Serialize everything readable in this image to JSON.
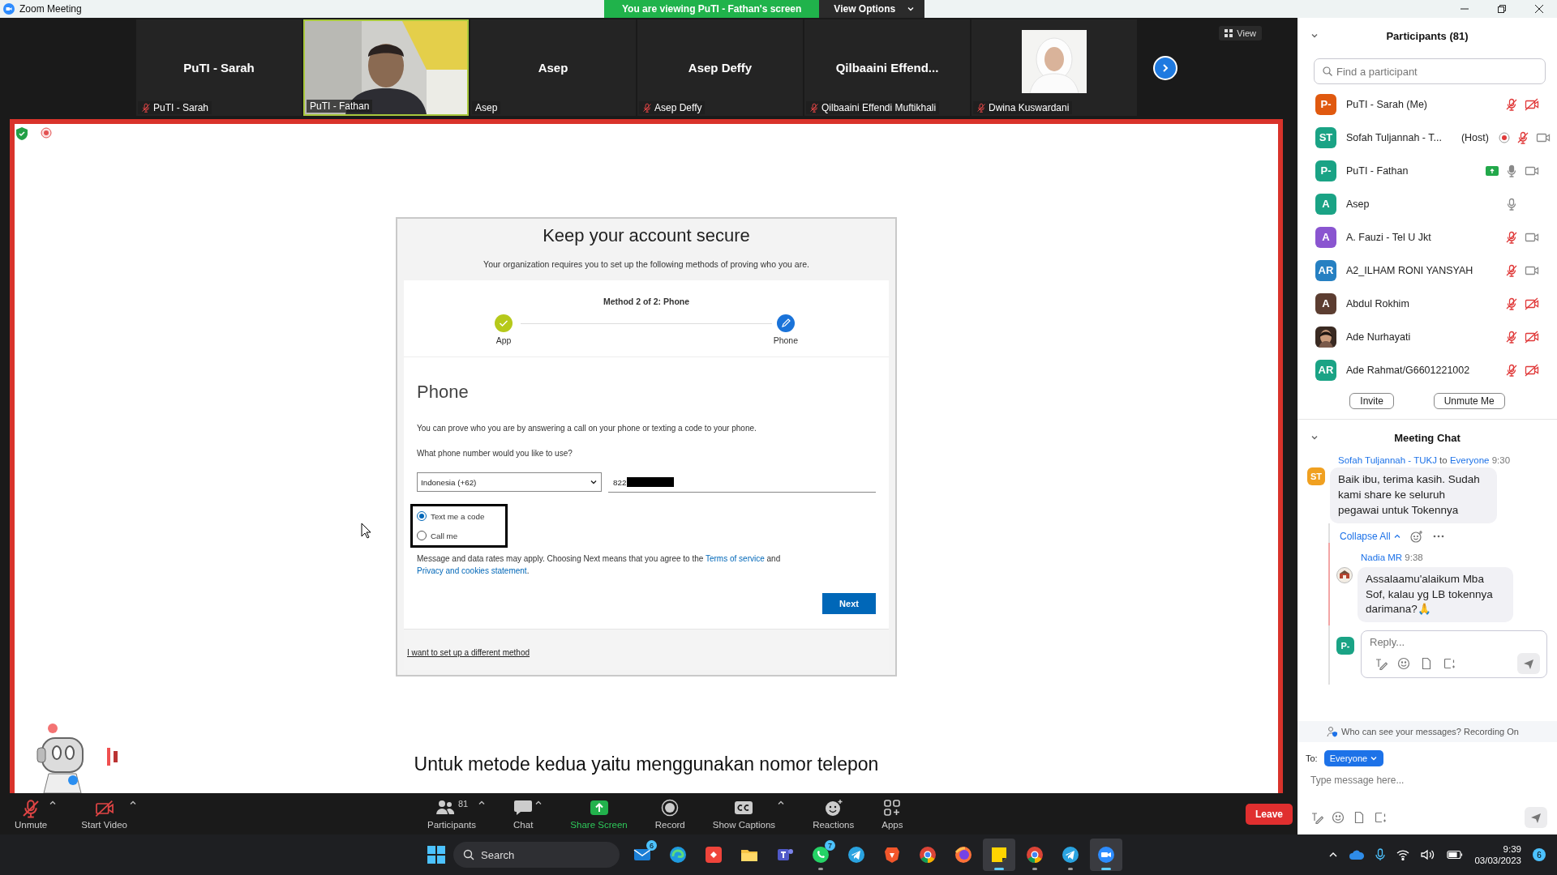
{
  "window": {
    "title": "Zoom Meeting"
  },
  "share_banner": {
    "text": "You are viewing PuTI - Fathan's screen",
    "button": "View Options"
  },
  "gallery": {
    "view_button": "View",
    "tiles": [
      {
        "kind": "name",
        "display": "PuTI - Sarah",
        "label": "PuTI - Sarah",
        "muted": true,
        "active": false
      },
      {
        "kind": "video",
        "label": "PuTI - Fathan",
        "muted": false,
        "active": true
      },
      {
        "kind": "name",
        "display": "Asep",
        "label": "Asep",
        "muted": false,
        "active": false
      },
      {
        "kind": "name",
        "display": "Asep Deffy",
        "label": "Asep Deffy",
        "muted": true,
        "active": false
      },
      {
        "kind": "name",
        "display": "Qilbaaini  Effend...",
        "label": "Qilbaaini Effendi Muftikhali",
        "muted": true,
        "active": false
      },
      {
        "label": "Dwina Kuswardani",
        "muted": true,
        "active": false
      }
    ]
  },
  "shared_screen": {
    "form": {
      "title": "Keep your account secure",
      "subtitle": "Your organization requires you to set up the following methods of proving who you are.",
      "method_label": "Method 2 of 2: Phone",
      "steps": [
        {
          "label": "App",
          "kind": "done"
        },
        {
          "label": "Phone",
          "kind": "current"
        }
      ],
      "heading": "Phone",
      "description": "You can prove who you are by answering a call on your phone or texting a code to your phone.",
      "question": "What phone number would you like to use?",
      "country": "Indonesia (+62)",
      "phone": "822",
      "options": [
        {
          "label": "Text me a code",
          "selected": true
        },
        {
          "label": "Call me",
          "selected": false
        }
      ],
      "legal": {
        "before": "Message and data rates may apply. Choosing Next means that you agree to the ",
        "link_1": "Terms of service",
        "middle": " and ",
        "link_2": "Privacy and cookies statement",
        "after": "."
      },
      "next_button": "Next",
      "alt_link": "I want to set up a different method"
    },
    "caption": "Untuk metode kedua yaitu menggunakan nomor telepon"
  },
  "participants": {
    "title": "Participants (81)",
    "search": {
      "placeholder": "Find a participant"
    },
    "items": [
      {
        "kind": "initials",
        "initials": "P-",
        "color": "#e0590f",
        "name": "PuTI - Sarah (Me)",
        "recording": false,
        "sharing": false,
        "muted": true,
        "talking": false,
        "video_off": true
      },
      {
        "kind": "initials",
        "initials": "ST",
        "color": "#1aa385",
        "name": "Sofah Tuljannah - T...",
        "role": "(Host)",
        "recording": true,
        "sharing": false,
        "muted": true,
        "talking": false,
        "video_off": false
      },
      {
        "kind": "initials",
        "initials": "P-",
        "color": "#1aa385",
        "name": "PuTI - Fathan",
        "recording": false,
        "sharing": true,
        "muted": false,
        "talking": true,
        "video_off": false
      },
      {
        "kind": "initials",
        "initials": "A",
        "color": "#1aa385",
        "name": "Asep",
        "recording": false,
        "sharing": false,
        "muted": false,
        "talking": false
      },
      {
        "kind": "initials",
        "initials": "A",
        "color": "#8a55d0",
        "name": "A. Fauzi - Tel U Jkt",
        "recording": false,
        "sharing": false,
        "muted": true,
        "talking": false,
        "video_off": false
      },
      {
        "kind": "initials",
        "initials": "AR",
        "color": "#2680c2",
        "name": "A2_ILHAM RONI YANSYAH",
        "recording": false,
        "sharing": false,
        "muted": true,
        "talking": false,
        "video_off": false
      },
      {
        "kind": "initials",
        "initials": "A",
        "color": "#5c3d31",
        "name": "Abdul Rokhim",
        "recording": false,
        "sharing": false,
        "muted": true,
        "talking": false,
        "video_off": true
      },
      {
        "kind": "picture",
        "name": "Ade Nurhayati",
        "recording": false,
        "sharing": false,
        "muted": true,
        "talking": false,
        "video_off": true
      },
      {
        "kind": "initials",
        "initials": "AR",
        "color": "#1aa385",
        "name": "Ade Rahmat/G6601221002",
        "recording": false,
        "sharing": false,
        "muted": true,
        "talking": false,
        "video_off": true
      }
    ],
    "buttons": [
      "Invite",
      "Unmute Me"
    ]
  },
  "chat": {
    "title": "Meeting Chat",
    "message": {
      "sender": "Sofah Tuljannah - TUKJ",
      "to_word": "to",
      "recipient": "Everyone",
      "time": "9:30",
      "initials": "ST",
      "color": "#f0a020",
      "text": "Baik ibu, terima kasih. Sudah kami share ke seluruh pegawai untuk Tokennya"
    },
    "collapse": "Collapse All",
    "reply": {
      "sender": "Nadia MR",
      "time": "9:38",
      "text": "Assalaamu'alaikum Mba Sof, kalau yg LB tokennya darimana?🙏"
    },
    "reply_field": {
      "initials": "P-",
      "placeholder": "Reply..."
    },
    "notice": "Who can see your messages? Recording On",
    "to_label": "To:",
    "recipient_button": "Everyone",
    "compose": {
      "placeholder": "Type message here..."
    }
  },
  "toolbar": {
    "items": [
      {
        "kind": "mic",
        "label": "Unmute",
        "menu": true
      },
      {
        "kind": "video",
        "label": "Start Video",
        "menu": true
      },
      {
        "kind": "people",
        "label": "Participants",
        "count": "81",
        "menu": true
      },
      {
        "kind": "chat",
        "label": "Chat",
        "menu": true
      },
      {
        "kind": "share",
        "label": "Share Screen",
        "menu": false
      },
      {
        "kind": "record",
        "label": "Record",
        "menu": false
      },
      {
        "kind": "captions",
        "label": "Show Captions",
        "menu": true
      },
      {
        "kind": "reactions",
        "label": "Reactions",
        "menu": false
      },
      {
        "kind": "apps",
        "label": "Apps",
        "menu": false
      }
    ],
    "leave": "Leave"
  },
  "taskbar": {
    "search": "Search",
    "apps": [
      {
        "kind": "mail",
        "badge": "6",
        "open": false,
        "selected": false
      },
      {
        "kind": "edge",
        "open": false,
        "selected": false
      },
      {
        "kind": "remote",
        "open": false,
        "selected": false
      },
      {
        "kind": "folder",
        "open": false,
        "selected": false
      },
      {
        "kind": "teams",
        "open": false,
        "selected": false
      },
      {
        "kind": "whatsapp",
        "badge": "7",
        "open": true,
        "selected": false
      },
      {
        "kind": "telegram",
        "open": false,
        "selected": false
      },
      {
        "kind": "brave",
        "open": false,
        "selected": false
      },
      {
        "kind": "chrome",
        "open": false,
        "selected": false
      },
      {
        "kind": "firefox",
        "open": false,
        "selected": false
      },
      {
        "kind": "notes",
        "open": true,
        "selected": true
      },
      {
        "kind": "chrome",
        "open": true,
        "selected": false
      },
      {
        "kind": "telegram",
        "open": true,
        "selected": false
      },
      {
        "kind": "zoom",
        "open": true,
        "selected": true
      }
    ],
    "time": "9:39",
    "date": "03/03/2023",
    "notifications": "6"
  }
}
